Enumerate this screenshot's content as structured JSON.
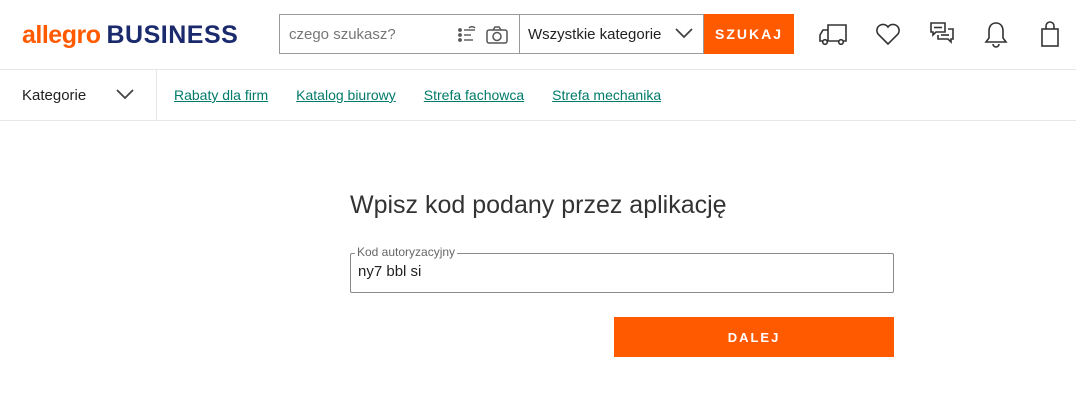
{
  "logo": {
    "brand": "allegro",
    "business": "BUSINESS"
  },
  "search": {
    "placeholder": "czego szukasz?",
    "category_value": "Wszystkie kategorie",
    "button_label": "SZUKAJ"
  },
  "header_icons": [
    "truck-icon",
    "heart-icon",
    "chat-icon",
    "bell-icon",
    "bag-icon"
  ],
  "nav": {
    "categories_label": "Kategorie",
    "links": [
      "Rabaty dla firm",
      "Katalog biurowy",
      "Strefa fachowca",
      "Strefa mechanika"
    ]
  },
  "auth": {
    "title": "Wpisz kod podany przez aplikację",
    "field_label": "Kod autoryzacyjny",
    "field_value": "ny7 bbl si",
    "submit_label": "DALEJ"
  },
  "colors": {
    "accent": "#ff5a00",
    "brand_dark": "#1a2a6c",
    "link": "#007a6a"
  }
}
